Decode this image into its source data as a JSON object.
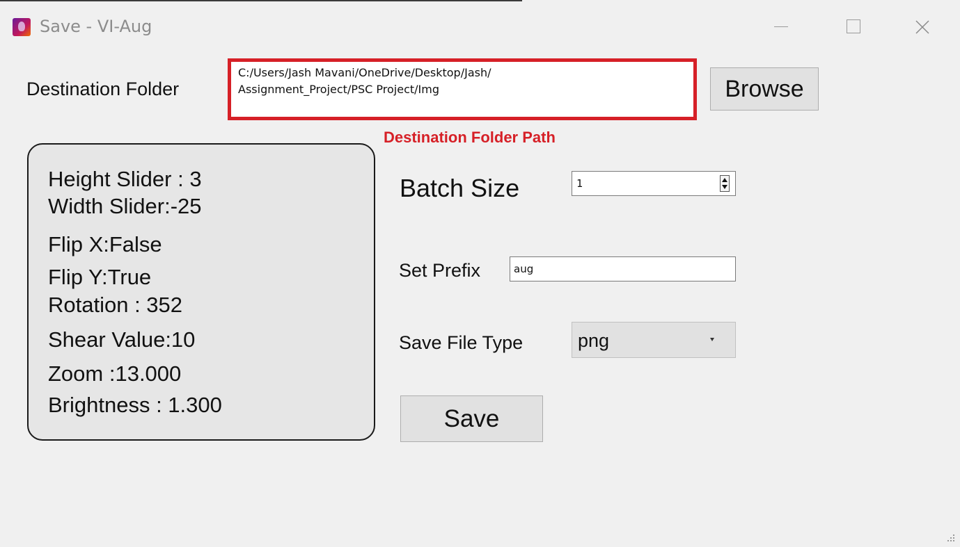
{
  "window": {
    "title": "Save - VI-Aug"
  },
  "destination": {
    "label": "Destination Folder",
    "path": "C:/Users/Jash Mavani/OneDrive/Desktop/Jash/\nAssignment_Project/PSC Project/Img",
    "browse_label": "Browse",
    "annotation": "Destination Folder Path",
    "annotation_color": "#d62027"
  },
  "params": [
    "Height Slider : 3",
    "Width Slider:-25",
    "Flip X:False",
    "Flip Y:True",
    "Rotation : 352",
    "Shear Value:10",
    "Zoom :13.000",
    "Brightness : 1.300"
  ],
  "batch": {
    "label": "Batch Size",
    "value": "1"
  },
  "prefix": {
    "label": "Set Prefix",
    "value": "aug"
  },
  "file_type": {
    "label": "Save File Type",
    "selected": "png"
  },
  "save_label": "Save",
  "icons": {
    "app": "app-icon",
    "minimize": "minimize-icon",
    "maximize": "maximize-icon",
    "close": "close-icon",
    "spin": "spin-arrows-icon",
    "dropdown": "chevron-down-icon"
  }
}
